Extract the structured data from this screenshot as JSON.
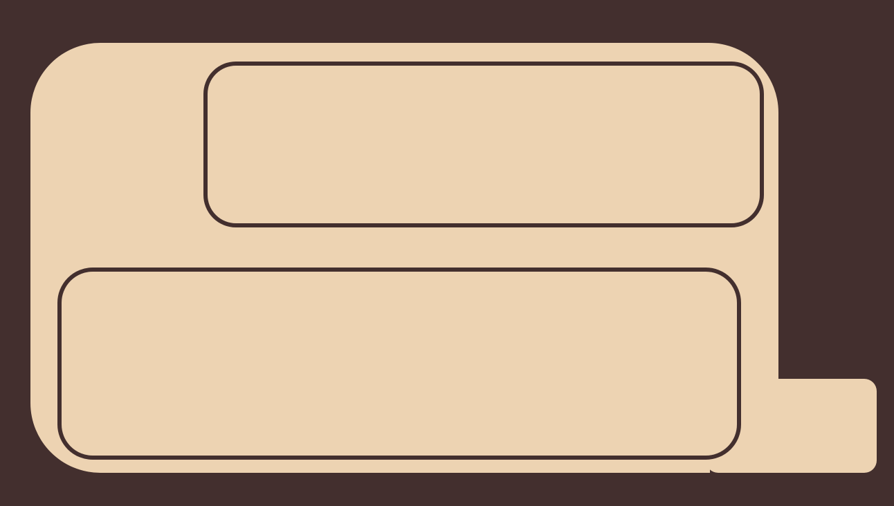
{
  "colors": {
    "background": "#432f2e",
    "card_fill": "#edd3b2",
    "outline": "#432f2e"
  },
  "card": {
    "panels": [
      {
        "name": "upper-panel",
        "text": ""
      },
      {
        "name": "lower-panel",
        "text": ""
      }
    ],
    "tab": {
      "text": ""
    }
  }
}
